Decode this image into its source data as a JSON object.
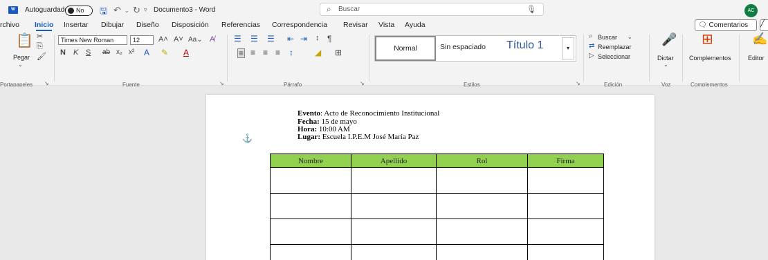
{
  "titlebar": {
    "logo": "W",
    "autosave_label": "Autoguardado",
    "autosave_state": "No",
    "doc_title": "Documento3 - Word",
    "search_placeholder": "Buscar",
    "avatar": "AC"
  },
  "menu": {
    "tabs": [
      "rchivo",
      "Inicio",
      "Insertar",
      "Dibujar",
      "Diseño",
      "Disposición",
      "Referencias",
      "Correspondencia",
      "Revisar",
      "Vista",
      "Ayuda"
    ],
    "comments": "Comentarios"
  },
  "ribbon": {
    "paste": "Pegar",
    "font_name": "Times New Roman",
    "font_size": "12",
    "styles": {
      "normal": "Normal",
      "no_spacing": "Sin espaciado",
      "title1": "Título 1"
    },
    "edit": {
      "search": "Buscar",
      "replace": "Reemplazar",
      "select": "Seleccionar"
    },
    "dictate": "Dictar",
    "addins": "Complementos",
    "editor": "Editor",
    "groups": {
      "clipboard": "Portapapeles",
      "font": "Fuente",
      "paragraph": "Párrafo",
      "styles": "Estilos",
      "editing": "Edición",
      "voice": "Voz",
      "addins": "Complementos"
    }
  },
  "document": {
    "lines": [
      {
        "label": "Evento",
        "sep": ": ",
        "value": "Acto de Reconocimiento Institucional"
      },
      {
        "label": "Fecha:",
        "sep": " ",
        "value": "15 de mayo"
      },
      {
        "label": "Hora:",
        "sep": " ",
        "value": "10:00 AM"
      },
      {
        "label": "Lugar:",
        "sep": " ",
        "value": "Escuela I.P.E.M José María Paz"
      }
    ],
    "table_headers": [
      "Nombre",
      "Apellido",
      "Rol",
      "Firma"
    ],
    "table_rows": 4
  },
  "colors": {
    "accent": "#185abd",
    "table_header": "#92d050",
    "title_style": "#2f5496"
  }
}
